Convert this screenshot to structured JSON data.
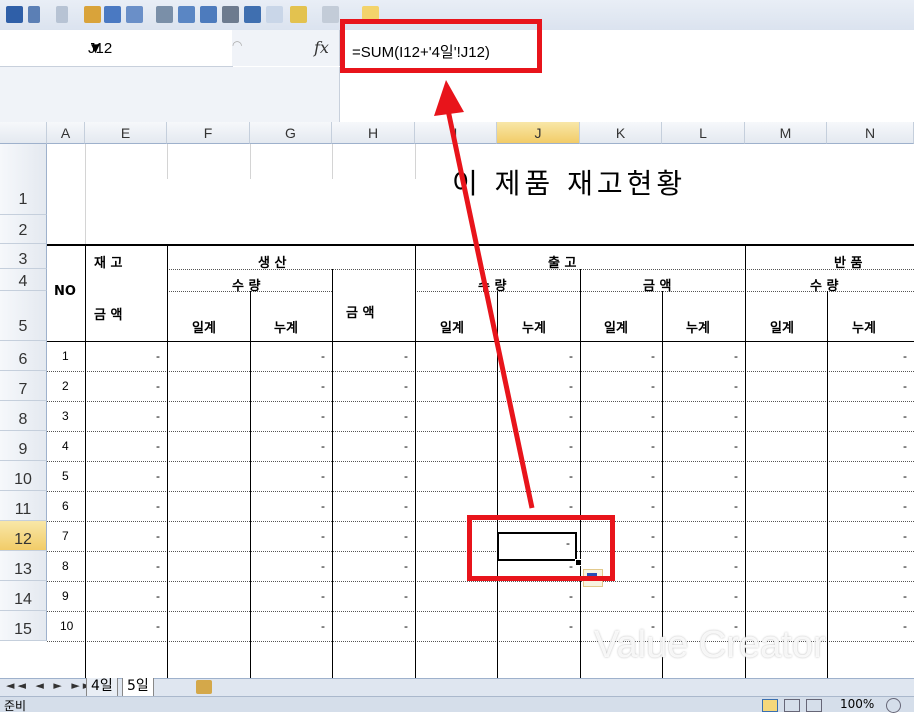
{
  "name_box": {
    "value": "J12"
  },
  "formula_bar": {
    "formula": "=SUM(I12+'4일'!J12)",
    "fx": "fx"
  },
  "columns": [
    "A",
    "E",
    "F",
    "G",
    "H",
    "I",
    "J",
    "K",
    "L",
    "M",
    "N"
  ],
  "rows": [
    "1",
    "2",
    "3",
    "4",
    "5",
    "6",
    "7",
    "8",
    "9",
    "10",
    "11",
    "12",
    "13",
    "14",
    "15"
  ],
  "sheet": {
    "title": "이   제품  재고현황",
    "header": {
      "no": "NO",
      "stock": "재 고",
      "amount1": "금    액",
      "production": "생      산",
      "qty": "수 량",
      "amount2": "금 액",
      "daily": "일계",
      "cumulative": "누계",
      "shipment": "출        고",
      "qty2": "수 량",
      "amount3": "금 액",
      "returns": "반      품",
      "qty3": "수 량"
    },
    "row_numbers": [
      "1",
      "2",
      "3",
      "4",
      "5",
      "6",
      "7",
      "8",
      "9",
      "10"
    ],
    "dash": "-"
  },
  "tabs": {
    "nav": "◄◄ ◄ ► ►►",
    "tab1": "4일",
    "tab2": "5일"
  },
  "status": {
    "ready": "준비",
    "zoom": "100%"
  },
  "watermark": "Value Creator",
  "accent": {
    "red": "#e8141b",
    "selected_header": "#f2cc68"
  }
}
